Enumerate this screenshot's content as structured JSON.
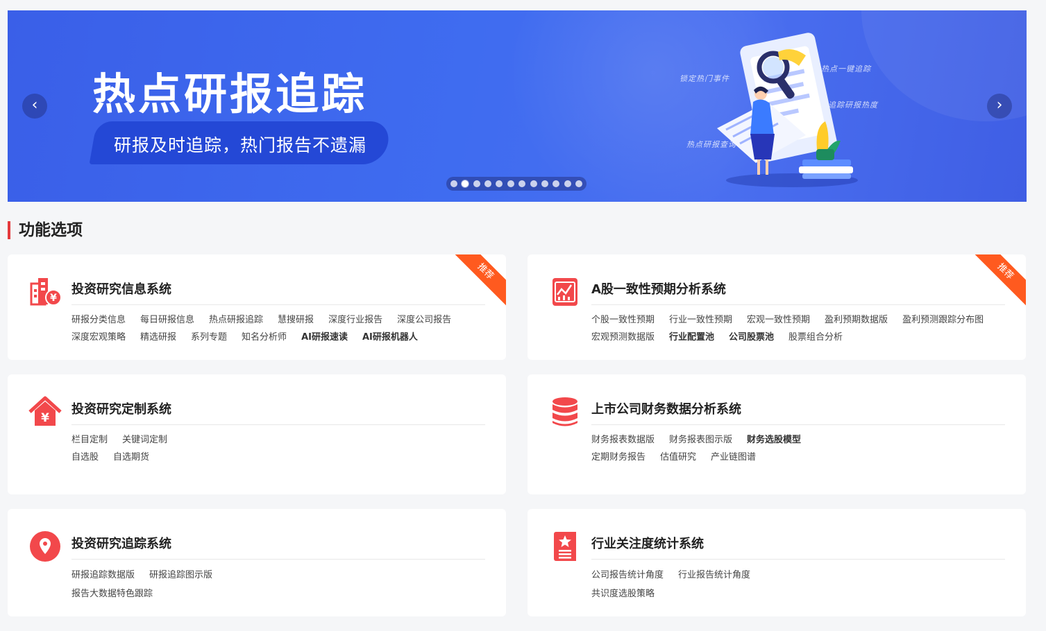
{
  "banner": {
    "title": "热点研报追踪",
    "subtitle": "研报及时追踪，热门报告不遗漏",
    "prev_glyph": "‹",
    "next_glyph": "›",
    "slide_count": 12,
    "active_slide": 2,
    "deco": [
      "锁定热门事件",
      "热点一键追踪",
      "追踪研报热度",
      "热点研报查询"
    ]
  },
  "section": {
    "title": "功能选项"
  },
  "badge_label": "推荐",
  "cards": [
    {
      "title": "投资研究信息系统",
      "icon": "building-yuan-icon",
      "badge": true,
      "rows": [
        [
          "研报分类信息",
          "每日研报信息",
          "热点研报追踪",
          "慧搜研报",
          "深度行业报告",
          "深度公司报告"
        ],
        [
          "深度宏观策略",
          "精选研报",
          "系列专题",
          "知名分析师",
          "AI研报速读",
          "AI研报机器人"
        ]
      ]
    },
    {
      "title": "A股一致性预期分析系统",
      "icon": "chart-board-icon",
      "badge": true,
      "rows": [
        [
          "个股一致性预期",
          "行业一致性预期",
          "宏观一致性预期",
          "盈利预期数据版",
          "盈利预测跟踪分布图"
        ],
        [
          "宏观预测数据版",
          "行业配置池",
          "公司股票池",
          "股票组合分析"
        ]
      ]
    },
    {
      "title": "投资研究定制系统",
      "icon": "house-yuan-icon",
      "badge": false,
      "rows": [
        [
          "栏目定制",
          "关键词定制"
        ],
        [
          "自选股",
          "自选期货"
        ]
      ]
    },
    {
      "title": "上市公司财务数据分析系统",
      "icon": "database-icon",
      "badge": false,
      "rows": [
        [
          "财务报表数据版",
          "财务报表图示版",
          "财务选股模型"
        ],
        [
          "定期财务报告",
          "估值研究",
          "产业链图谱"
        ]
      ]
    },
    {
      "title": "投资研究追踪系统",
      "icon": "location-pin-icon",
      "badge": false,
      "rows": [
        [
          "研报追踪数据版",
          "研报追踪图示版"
        ],
        [
          "报告大数据特色跟踪"
        ]
      ]
    },
    {
      "title": "行业关注度统计系统",
      "icon": "star-document-icon",
      "badge": false,
      "rows": [
        [
          "公司报告统计角度",
          "行业报告统计角度"
        ],
        [
          "共识度选股策略"
        ]
      ]
    }
  ],
  "colors": {
    "accent": "#e4393c",
    "banner_blue": "#3f6cf0",
    "badge": "#ff5a1f",
    "icon_red": "#f2484b"
  }
}
